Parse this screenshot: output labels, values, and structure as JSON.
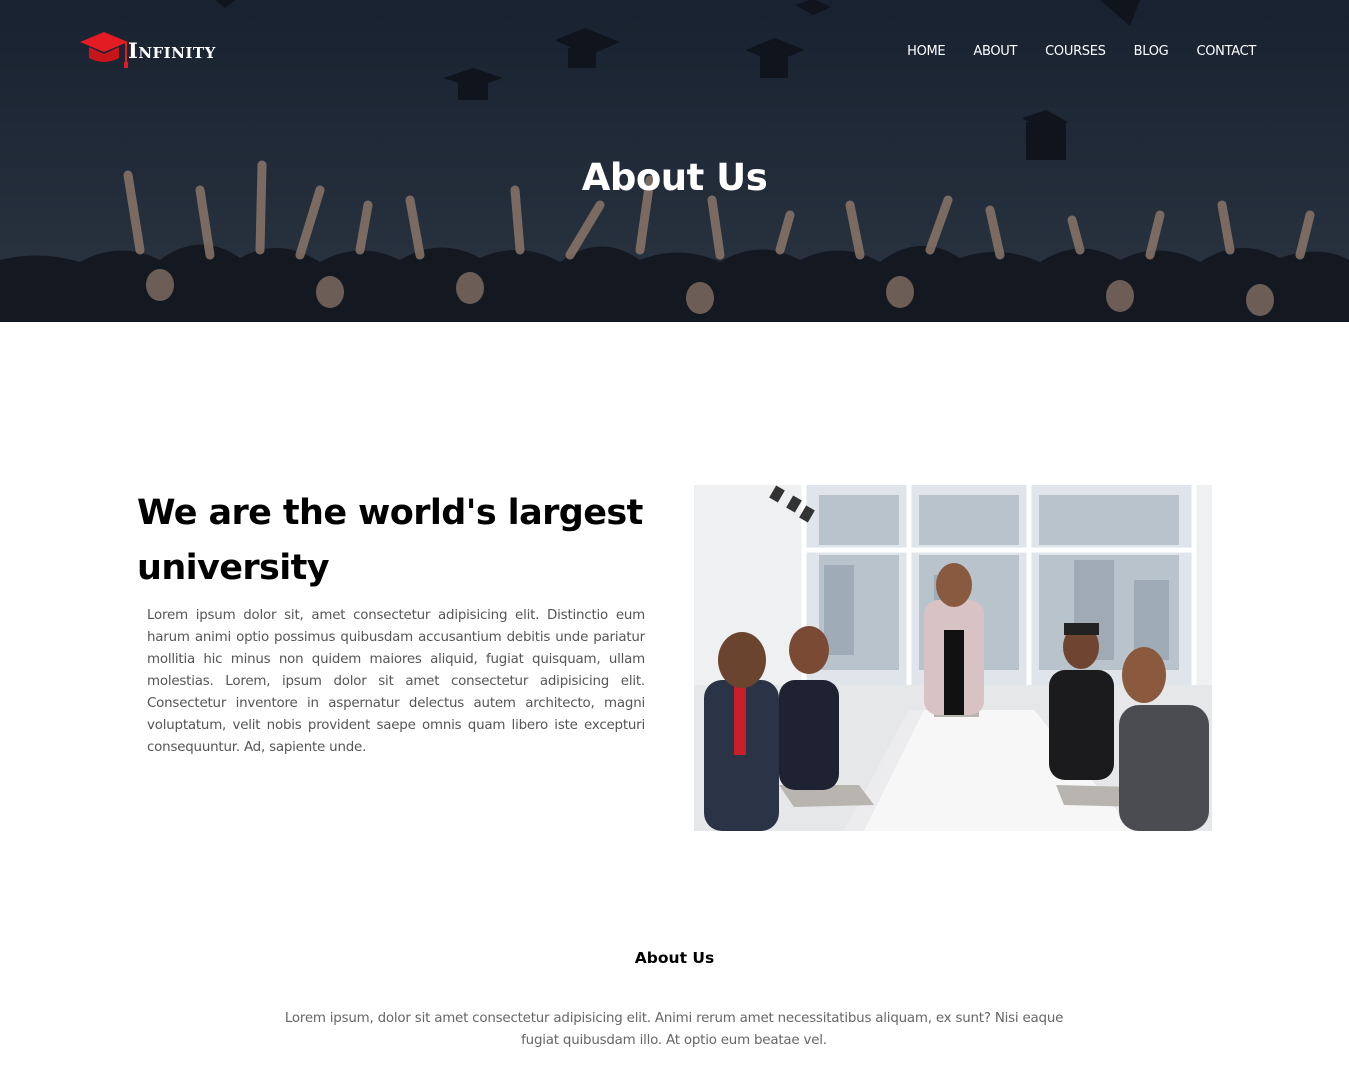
{
  "brand": {
    "name": "Infinity",
    "accent_color": "#e31b23",
    "icon": "graduation-cap-icon"
  },
  "nav": {
    "items": [
      "HOME",
      "ABOUT",
      "COURSES",
      "BLOG",
      "CONTACT"
    ]
  },
  "hero": {
    "title": "About Us",
    "image": "graduates-throwing-caps-photo"
  },
  "about": {
    "heading": "We are the world's largest university",
    "text": "Lorem ipsum dolor sit, amet consectetur adipisicing elit. Distinctio eum harum animi optio possimus quibusdam accusantium debitis unde pariatur mollitia hic minus non quidem maiores aliquid, fugiat quisquam, ullam molestias. Lorem, ipsum dolor sit amet consectetur adipisicing elit. Consectetur inventore in aspernatur delectus autem architecto, magni voluptatum, velit nobis provident saepe omnis quam libero iste excepturi consequuntur. Ad, sapiente unde.",
    "image": "team-meeting-photo"
  },
  "section2": {
    "title": "About Us",
    "text": "Lorem ipsum, dolor sit amet consectetur adipisicing elit. Animi rerum amet necessitatibus aliquam, ex sunt? Nisi eaque fugiat quibusdam illo. At optio eum beatae vel."
  }
}
